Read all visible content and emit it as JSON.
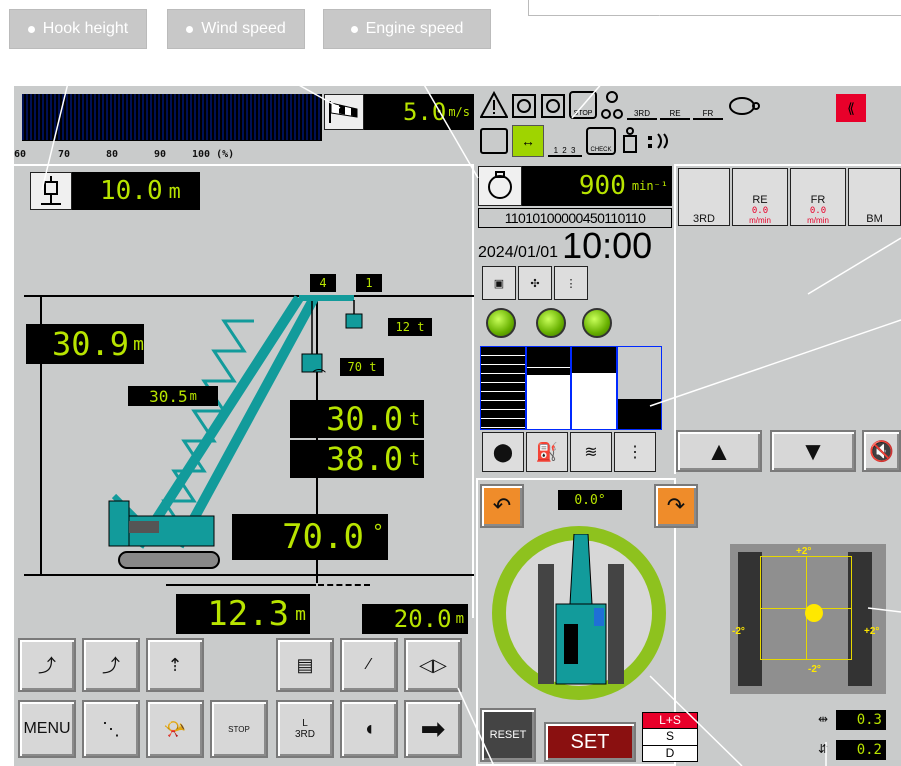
{
  "callouts": {
    "hook_height": "Hook height",
    "wind_speed": "Wind speed",
    "engine_speed": "Engine speed"
  },
  "wind": {
    "value": "5.0",
    "unit": "m/s"
  },
  "load_scale": {
    "labels": [
      "60",
      "70",
      "80",
      "90",
      "100 (%)"
    ]
  },
  "hook_height": {
    "value": "10.0",
    "unit": "m"
  },
  "engine": {
    "value": "900",
    "unit": "min⁻¹"
  },
  "code": "11010100000450110110",
  "date": "2024/01/01",
  "time": "10:00",
  "drums": [
    {
      "label": "3RD",
      "speed": ""
    },
    {
      "label": "RE",
      "speed": "0.0"
    },
    {
      "label": "FR",
      "speed": "0.0"
    },
    {
      "label": "BM",
      "speed": ""
    }
  ],
  "drum_speed_unit": "m/min",
  "crane": {
    "boom_badge_1": "4",
    "boom_badge_2": "1",
    "aux_load": "12 t",
    "main_load": "70 t",
    "height": "30.9",
    "height_unit": "m",
    "jib_length": "30.5",
    "jib_unit": "m",
    "actual_load": "30.0",
    "rated_load": "38.0",
    "load_unit": "t",
    "angle": "70.0",
    "angle_unit": "°",
    "radius": "12.3",
    "radius_unit": "m",
    "radius_max": "20.0",
    "radius_max_unit": "m"
  },
  "bottom_buttons": {
    "menu": "MENU",
    "stop": "STOP",
    "third": "3RD",
    "l": "L"
  },
  "swing": {
    "angle": "0.0°"
  },
  "swing_buttons": {
    "reset": "RESET",
    "set": "SET",
    "mode_ls": "L+S",
    "mode_s": "S",
    "mode_d": "D"
  },
  "level": {
    "plus2_top": "+2°",
    "minus2_left": "-2°",
    "plus2_right": "+2°",
    "minus2_bottom": "-2°",
    "x_value": "0.3",
    "y_value": "0.2"
  },
  "icons": {
    "stop_badge": "STOP",
    "check_badge": "CHECK",
    "drum_3rd": "3RD",
    "drum_re": "RE",
    "drum_fr": "FR",
    "hoist_123": "1 2 3"
  },
  "colors": {
    "lcd_text": "#b8e400",
    "crane_body": "#129b9b",
    "swing_ring": "#8ec21e",
    "level_dot": "#ffe800",
    "warn_red": "#e8002a"
  }
}
